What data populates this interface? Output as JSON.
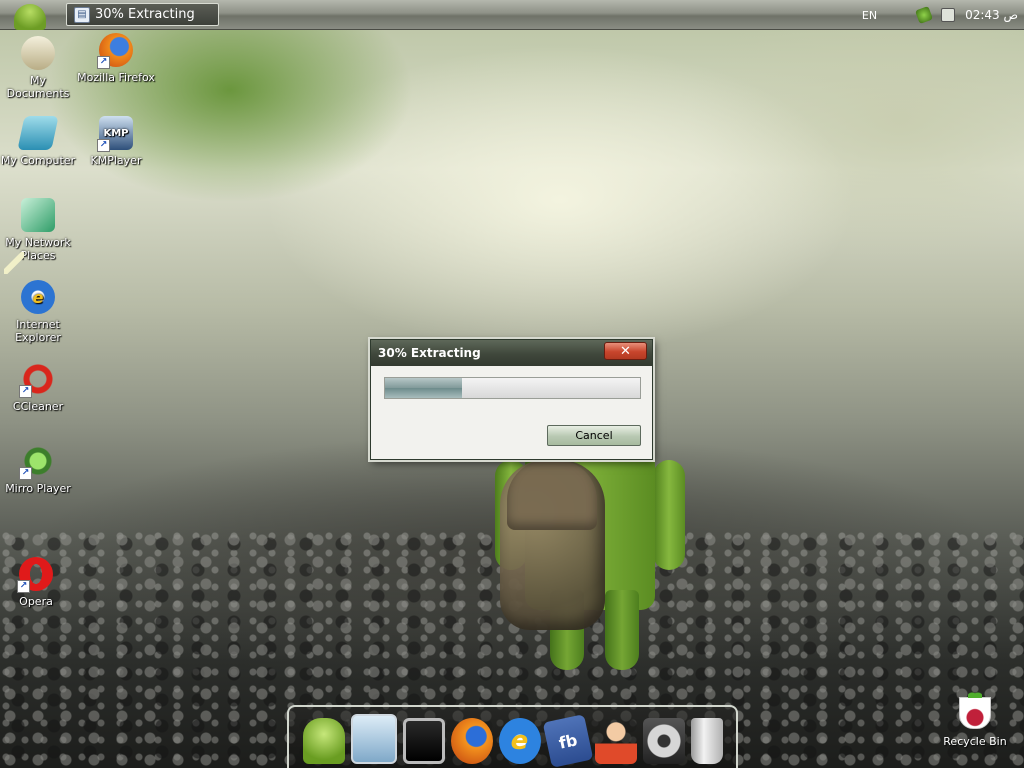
{
  "taskbar": {
    "task_button_label": "30% Extracting",
    "language": "EN",
    "clock_time": "02:43",
    "clock_ampm": "ص"
  },
  "desktop_icons": {
    "my_documents": "My Documents",
    "mozilla_firefox": "Mozilla Firefox",
    "my_computer": "My Computer",
    "kmplayer": "KMPlayer",
    "network_places": "My Network Places",
    "internet_explorer": "Internet Explorer",
    "ccleaner": "CCleaner",
    "mirro_player": "Mirro Player",
    "opera": "Opera",
    "recycle_bin": "Recycle Bin"
  },
  "dialog": {
    "title": "30% Extracting",
    "close_glyph": "✕",
    "progress_percent": 30,
    "cancel_label": "Cancel"
  },
  "dock": {
    "items": [
      "android-icon",
      "network-icon",
      "tablet-icon",
      "firefox-icon",
      "internet-explorer-icon",
      "facebook-icon",
      "user-support-icon",
      "settings-gear-icon",
      "trash-icon"
    ],
    "facebook_glyph": "fb"
  },
  "colors": {
    "close_button": "#c8452c",
    "progress_fill": "#819a9a",
    "android_green": "#7fb13a"
  }
}
